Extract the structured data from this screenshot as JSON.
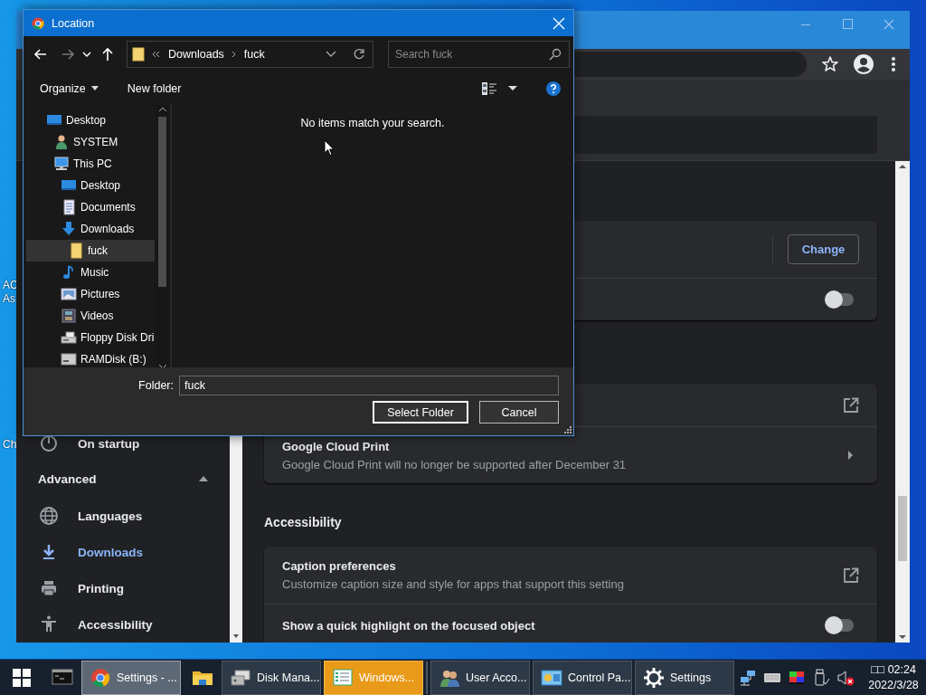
{
  "desktop": {
    "icon_labels": [
      {
        "text": "AC"
      },
      {
        "text": "As"
      },
      {
        "text": "Ch"
      }
    ]
  },
  "browser": {
    "sidebar": {
      "items": [
        {
          "kind": "startup",
          "label": "On startup",
          "selected": false
        },
        {
          "kind": "section",
          "label": "Advanced",
          "expanded": true
        },
        {
          "kind": "languages",
          "label": "Languages",
          "selected": false
        },
        {
          "kind": "downloads",
          "label": "Downloads",
          "selected": true
        },
        {
          "kind": "printing",
          "label": "Printing",
          "selected": false
        },
        {
          "kind": "accessibility",
          "label": "Accessibility",
          "selected": false
        }
      ]
    },
    "main": {
      "blocks": [
        {
          "kind": "card",
          "rows": [
            {
              "kind": "button",
              "button": "Change"
            },
            {
              "kind": "toggle",
              "on": false
            }
          ]
        },
        {
          "kind": "card",
          "rows": [
            {
              "kind": "external"
            },
            {
              "kind": "arrow",
              "title": "Google Cloud Print",
              "subtitle": "Google Cloud Print will no longer be supported after December 31"
            }
          ]
        },
        {
          "kind": "heading",
          "text": "Accessibility"
        },
        {
          "kind": "card",
          "rows": [
            {
              "kind": "external",
              "title": "Caption preferences",
              "subtitle": "Customize caption size and style for apps that support this setting"
            },
            {
              "kind": "toggle",
              "title": "Show a quick highlight on the focused object",
              "on": false
            }
          ]
        }
      ]
    }
  },
  "dialog": {
    "title": "Location",
    "back": {
      "disabled": false
    },
    "forward": {
      "disabled": true
    },
    "address": {
      "crumbs": [
        "Downloads",
        "fuck"
      ]
    },
    "search": {
      "placeholder": "Search fuck"
    },
    "commands": [
      {
        "label": "Organize",
        "menu": true
      },
      {
        "label": "New folder",
        "menu": false
      }
    ],
    "tree": [
      {
        "kind": "desktop",
        "label": "Desktop",
        "selected": false,
        "children": [
          {
            "kind": "user",
            "label": "SYSTEM",
            "selected": false
          },
          {
            "kind": "pc",
            "label": "This PC",
            "selected": false,
            "children": [
              {
                "kind": "desktop",
                "label": "Desktop",
                "selected": false
              },
              {
                "kind": "documents",
                "label": "Documents",
                "selected": false
              },
              {
                "kind": "downloads",
                "label": "Downloads",
                "selected": false,
                "children": [
                  {
                    "kind": "folder",
                    "label": "fuck",
                    "selected": true
                  }
                ]
              },
              {
                "kind": "music",
                "label": "Music",
                "selected": false
              },
              {
                "kind": "pictures",
                "label": "Pictures",
                "selected": false
              },
              {
                "kind": "videos",
                "label": "Videos",
                "selected": false
              },
              {
                "kind": "floppy",
                "label": "Floppy Disk Dri",
                "selected": false
              },
              {
                "kind": "drive",
                "label": "RAMDisk (B:)",
                "selected": false
              }
            ]
          }
        ]
      }
    ],
    "empty_message": "No items match your search.",
    "folder": {
      "label": "Folder:",
      "value": "fuck"
    },
    "buttons": [
      {
        "label": "Select Folder",
        "default": true
      },
      {
        "label": "Cancel",
        "default": false
      }
    ]
  },
  "taskbar": {
    "items": [
      {
        "kind": "console"
      },
      {
        "kind": "chrome",
        "label": "Settings - ...",
        "selected": true,
        "flashing": false
      },
      {
        "kind": "explorer"
      },
      {
        "kind": "disk",
        "label": "Disk Mana...",
        "selected": false,
        "flashing": false
      },
      {
        "kind": "list",
        "label": "Windows...",
        "selected": false,
        "flashing": true
      },
      {
        "kind": "users",
        "label": "User Acco...",
        "selected": false,
        "flashing": false
      },
      {
        "kind": "control",
        "label": "Control Pa...",
        "selected": false,
        "flashing": false
      },
      {
        "kind": "gear",
        "label": "Settings",
        "selected": false,
        "flashing": false
      }
    ],
    "tray": [
      {
        "kind": "network"
      },
      {
        "kind": "keyboard"
      },
      {
        "kind": "color"
      },
      {
        "kind": "usb"
      },
      {
        "kind": "volume",
        "muted": true
      }
    ],
    "clock": {
      "time": "□□ 02:24",
      "date": "2022/3/28"
    }
  }
}
